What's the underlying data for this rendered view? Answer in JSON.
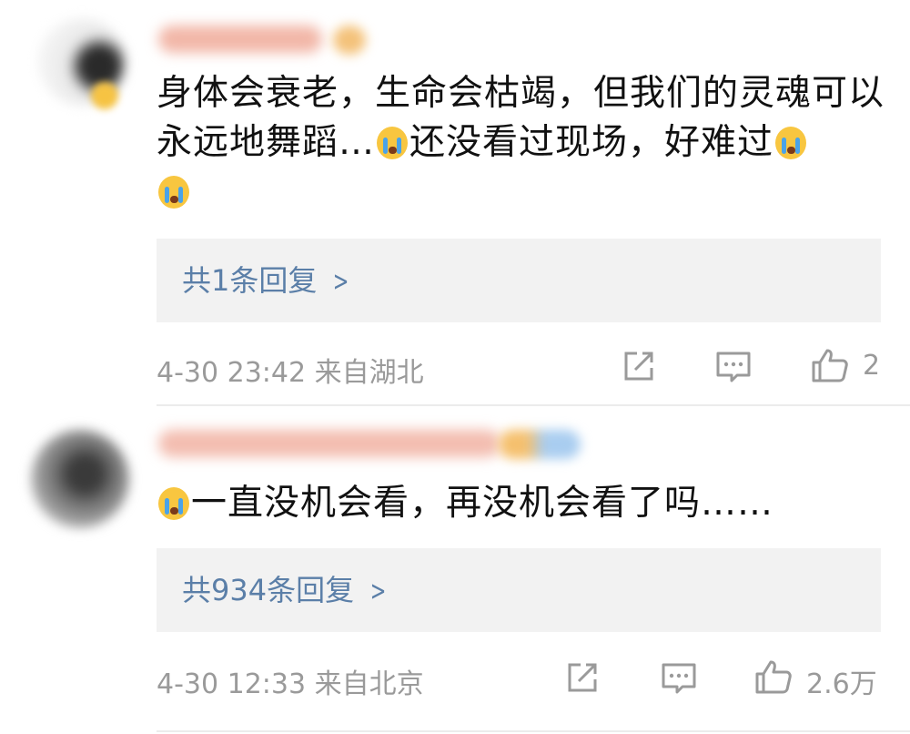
{
  "comments": [
    {
      "text_a": "身体会衰老，生命会枯竭，但我们的灵魂可以永远地舞蹈…",
      "text_b": "还没看过现场，好难过",
      "reply_label": "共1条回复",
      "time": "4-30 23:42",
      "location": "来自湖北",
      "likes": "2",
      "emoji": "crying-face"
    },
    {
      "text": "一直没机会看，再没机会看了吗……",
      "reply_label": "共934条回复",
      "time": "4-30 12:33",
      "location": "来自北京",
      "likes": "2.6万",
      "emoji": "crying-face"
    }
  ],
  "colors": {
    "link_blue": "#5b7fa8",
    "meta_gray": "#9a9a9a",
    "reply_bg": "#f2f2f2"
  }
}
